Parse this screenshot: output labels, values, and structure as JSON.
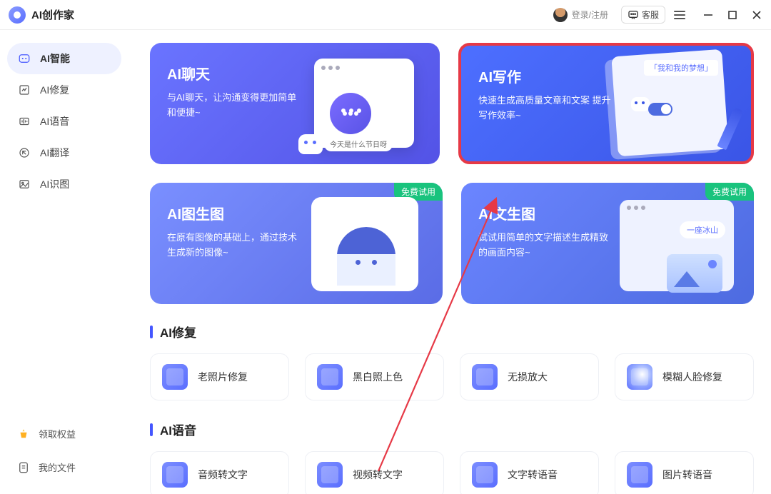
{
  "app": {
    "title": "AI创作家"
  },
  "header": {
    "login": "登录/注册",
    "kefu": "客服"
  },
  "sidebar": {
    "items": [
      {
        "label": "AI智能"
      },
      {
        "label": "AI修复"
      },
      {
        "label": "AI语音"
      },
      {
        "label": "AI翻译"
      },
      {
        "label": "AI识图"
      }
    ],
    "bottom": {
      "reward": "领取权益",
      "files": "我的文件"
    }
  },
  "cards": {
    "chat": {
      "title": "AI聊天",
      "desc": "与AI聊天，让沟通变得更加简单和便捷~",
      "tag": "今天是什么节日呀"
    },
    "write": {
      "title": "AI写作",
      "desc": "快速生成高质量文章和文案 提升写作效率~",
      "paper_label": "「我和我的梦想」"
    },
    "imggen": {
      "title": "AI图生图",
      "desc": "在原有图像的基础上，通过技术生成新的图像~",
      "badge": "免费试用"
    },
    "txtimg": {
      "title": "AI文生图",
      "desc": "试试用简单的文字描述生成精致的画面内容~",
      "badge": "免费试用",
      "pill": "一座冰山"
    }
  },
  "sections": {
    "repair": {
      "title": "AI修复",
      "tools": [
        {
          "label": "老照片修复"
        },
        {
          "label": "黑白照上色"
        },
        {
          "label": "无损放大"
        },
        {
          "label": "模糊人脸修复"
        }
      ]
    },
    "audio": {
      "title": "AI语音",
      "tools": [
        {
          "label": "音频转文字"
        },
        {
          "label": "视频转文字"
        },
        {
          "label": "文字转语音"
        },
        {
          "label": "图片转语音"
        }
      ]
    }
  }
}
